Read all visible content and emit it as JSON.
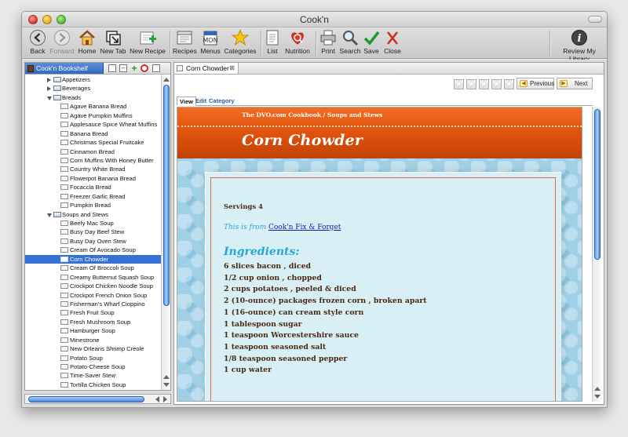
{
  "window": {
    "title": "Cook'n"
  },
  "toolbar": {
    "back": "Back",
    "forward": "Forward",
    "home": "Home",
    "new_tab": "New Tab",
    "new_recipe": "New Recipe",
    "recipes": "Recipes",
    "menus": "Menus",
    "menus_icon_text": "MON",
    "categories": "Categories",
    "list": "List",
    "nutrition": "Nutrition",
    "print": "Print",
    "search": "Search",
    "save": "Save",
    "close": "Close",
    "review": "Review My Library"
  },
  "left_panel": {
    "tab_label": "Cook'n Bookshelf",
    "tree": [
      {
        "label": "Appetizers",
        "level": 1,
        "type": "book",
        "state": "collapsed"
      },
      {
        "label": "Beverages",
        "level": 1,
        "type": "book",
        "state": "collapsed"
      },
      {
        "label": "Breads",
        "level": 1,
        "type": "book",
        "state": "expanded"
      },
      {
        "label": "Agave Banana Bread",
        "level": 2,
        "type": "recipe"
      },
      {
        "label": "Agave Pumpkin Muffins",
        "level": 2,
        "type": "recipe"
      },
      {
        "label": "Applesauce Spice Wheat Muffins",
        "level": 2,
        "type": "recipe"
      },
      {
        "label": "Banana Bread",
        "level": 2,
        "type": "recipe"
      },
      {
        "label": "Christmas Special Fruitcake",
        "level": 2,
        "type": "recipe"
      },
      {
        "label": "Cinnamon Bread",
        "level": 2,
        "type": "recipe"
      },
      {
        "label": "Corn Muffins With Honey Butter",
        "level": 2,
        "type": "recipe"
      },
      {
        "label": "Country White Bread",
        "level": 2,
        "type": "recipe"
      },
      {
        "label": "Flowerpot Banana Bread",
        "level": 2,
        "type": "recipe"
      },
      {
        "label": "Focaccia Bread",
        "level": 2,
        "type": "recipe"
      },
      {
        "label": "Freezer Garlic Bread",
        "level": 2,
        "type": "recipe"
      },
      {
        "label": "Pumpkin Bread",
        "level": 2,
        "type": "recipe"
      },
      {
        "label": "Soups and Stews",
        "level": 1,
        "type": "book",
        "state": "expanded"
      },
      {
        "label": "Beefy Mac Soup",
        "level": 2,
        "type": "recipe"
      },
      {
        "label": "Busy Day Beef Stew",
        "level": 2,
        "type": "recipe"
      },
      {
        "label": "Busy Day Oven Stew",
        "level": 2,
        "type": "recipe"
      },
      {
        "label": "Cream Of Avocado Soup",
        "level": 2,
        "type": "recipe"
      },
      {
        "label": "Corn Chowder",
        "level": 2,
        "type": "recipe",
        "selected": true
      },
      {
        "label": "Cream Of Broccoli Soup",
        "level": 2,
        "type": "recipe"
      },
      {
        "label": "Creamy Butternut Squash Soup",
        "level": 2,
        "type": "recipe"
      },
      {
        "label": "Crockpot Chicken Noodle Soup",
        "level": 2,
        "type": "recipe"
      },
      {
        "label": "Crockpot French Onion Soup",
        "level": 2,
        "type": "recipe"
      },
      {
        "label": "Fisherman's Wharf Cioppino",
        "level": 2,
        "type": "recipe"
      },
      {
        "label": "Fresh Fruit Soup",
        "level": 2,
        "type": "recipe"
      },
      {
        "label": "Fresh Mushroom Soup",
        "level": 2,
        "type": "recipe"
      },
      {
        "label": "Hamburger Soup",
        "level": 2,
        "type": "recipe"
      },
      {
        "label": "Minestrone",
        "level": 2,
        "type": "recipe"
      },
      {
        "label": "New Orleans Shrimp Creole",
        "level": 2,
        "type": "recipe"
      },
      {
        "label": "Potato Soup",
        "level": 2,
        "type": "recipe"
      },
      {
        "label": "Potato-Cheese Soup",
        "level": 2,
        "type": "recipe"
      },
      {
        "label": "Time-Saver Stew",
        "level": 2,
        "type": "recipe"
      },
      {
        "label": "Tortilla Chicken Soup",
        "level": 2,
        "type": "recipe"
      }
    ]
  },
  "right_panel": {
    "tab_label": "Corn Chowder",
    "rating": {
      "stars": 5,
      "filled": 0
    },
    "previous": "Previous",
    "next": "Next",
    "subtabs": [
      "View",
      "Edit",
      "Category"
    ],
    "recipe": {
      "cookbook": "The DVO.com Cookbook / Soups and Stews",
      "title": "Corn Chowder",
      "servings": "Servings 4",
      "from_prefix": "This is from ",
      "from_link": "Cook'n Fix & Forget",
      "ingredients_heading": "Ingredients:",
      "ingredients": [
        "6 slices bacon , diced",
        "1/2 cup onion , chopped",
        "2 cups potatoes , peeled & diced",
        "2 (10-ounce) packages frozen corn , broken apart",
        "1 (16-ounce) can cream style corn",
        "1 tablespoon sugar",
        "1 teaspoon Worcestershire sauce",
        "1 teaspoon seasoned salt",
        "1/8 teaspoon seasoned pepper",
        "1 cup water"
      ]
    }
  },
  "colors": {
    "header_orange": "#e45a14",
    "selection_blue": "#3672d6",
    "accent_cyan": "#2aa6d6",
    "text_brown": "#4a2a10"
  }
}
